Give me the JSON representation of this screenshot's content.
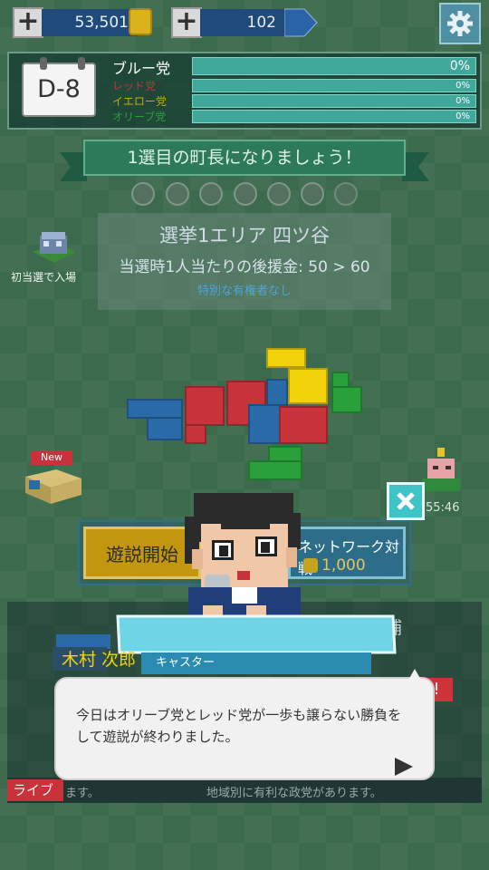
{
  "currency": {
    "coins": "53,501",
    "tickets": "102"
  },
  "icons": {
    "add_coins": "plus-icon",
    "add_tickets": "plus-icon",
    "coin": "coin-icon",
    "ticket": "ticket-icon",
    "settings": "gear-icon",
    "close": "close-icon",
    "next": "triangle-right-icon"
  },
  "calendar": {
    "day": "D-8"
  },
  "parties": [
    {
      "name": "ブルー党",
      "percent": "0%"
    },
    {
      "name": "レッド党",
      "percent": "0%"
    },
    {
      "name": "イエロー党",
      "percent": "0%"
    },
    {
      "name": "オリーブ党",
      "percent": "0%"
    }
  ],
  "mission": {
    "banner": "1選目の町長になりましょう！"
  },
  "area": {
    "title": "選挙1エリア 四ツ谷",
    "bonus": "当選時1人当たりの後援金: 50 > 60",
    "note": "特別な有権者なし"
  },
  "side": {
    "entry_label": "初当選で入場",
    "new_badge": "New",
    "timer": "55:46"
  },
  "buttons": {
    "start": "遊説開始",
    "network": "ネットワーク対戦",
    "network_cost": "1,000"
  },
  "bottom": {
    "candidate_label": "候補",
    "live_tag": "ライブ",
    "ticker_left": "ます。",
    "ticker_right": "地域別に有利な政党があります。"
  },
  "dialog": {
    "speaker_name": "木村 次郎",
    "speaker_role": "キャスター",
    "message": "今日はオリーブ党とレッド党が一歩も譲らない勝負をして遊説が終わりました。"
  },
  "colors": {
    "background": "#3c6a4c",
    "blue_party": "#2a6aa8",
    "red_party": "#c7323b",
    "yellow_party": "#f2d20b",
    "olive_party": "#2aa03a"
  }
}
